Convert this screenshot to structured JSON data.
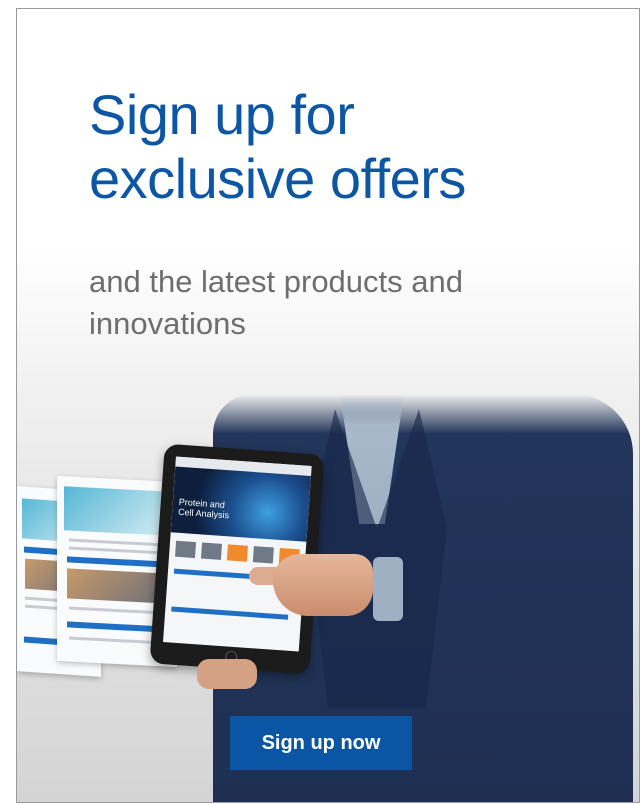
{
  "banner": {
    "headline_line1": "Sign up for",
    "headline_line2": "exclusive offers",
    "subheadline_line1": "and the latest products and",
    "subheadline_line2": "innovations",
    "cta_label": "Sign up now"
  },
  "tablet_screen": {
    "feature_line1": "Protein and",
    "feature_line2": "Cell Analysis"
  },
  "colors": {
    "headline": "#0d56a3",
    "cta_background": "#0b56a4",
    "subheadline": "#6e6e6e"
  }
}
